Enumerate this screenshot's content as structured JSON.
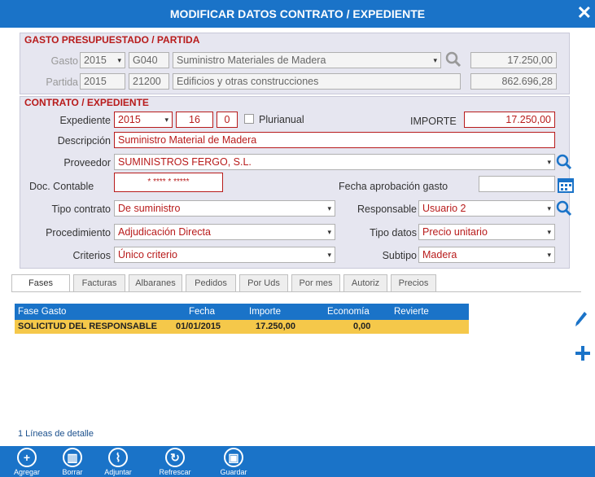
{
  "title": "MODIFICAR DATOS CONTRATO / EXPEDIENTE",
  "gasto_section": {
    "title": "GASTO PRESUPUESTADO / PARTIDA",
    "gasto_label": "Gasto",
    "gasto_year": "2015",
    "gasto_code": "G040",
    "gasto_desc": "Suministro Materiales de Madera",
    "gasto_amount": "17.250,00",
    "partida_label": "Partida",
    "partida_year": "2015",
    "partida_code": "21200",
    "partida_desc": "Edificios y otras construcciones",
    "partida_amount": "862.696,28"
  },
  "contrato_section": {
    "title": "CONTRATO / EXPEDIENTE",
    "expediente_label": "Expediente",
    "expediente_year": "2015",
    "expediente_num": "16",
    "expediente_sub": "0",
    "plurianual_label": "Plurianual",
    "importe_label": "IMPORTE",
    "importe_value": "17.250,00",
    "descripcion_label": "Descripción",
    "descripcion_value": "Suministro Material de Madera",
    "proveedor_label": "Proveedor",
    "proveedor_value": "SUMINISTROS FERGO, S.L.",
    "doc_contable_label": "Doc. Contable",
    "doc_contable_value": "* **** * *****",
    "fecha_aprobacion_label": "Fecha aprobación gasto",
    "fecha_aprobacion_value": "",
    "tipo_contrato_label": "Tipo contrato",
    "tipo_contrato_value": "De suministro",
    "responsable_label": "Responsable",
    "responsable_value": "Usuario 2",
    "procedimiento_label": "Procedimiento",
    "procedimiento_value": "Adjudicación Directa",
    "tipo_datos_label": "Tipo datos",
    "tipo_datos_value": "Precio unitario",
    "criterios_label": "Criterios",
    "criterios_value": "Único criterio",
    "subtipo_label": "Subtipo",
    "subtipo_value": "Madera"
  },
  "tabs": [
    "Fases",
    "Facturas",
    "Albaranes",
    "Pedidos",
    "Por Uds",
    "Por mes",
    "Autoriz",
    "Precios"
  ],
  "grid": {
    "headers": [
      "Fase Gasto",
      "Fecha",
      "Importe",
      "Economía",
      "Revierte"
    ],
    "rows": [
      [
        "SOLICITUD DEL RESPONSABLE",
        "01/01/2015",
        "17.250,00",
        "0,00",
        ""
      ]
    ],
    "footer": "1 Líneas de detalle"
  },
  "bottom_buttons": [
    "Agregar",
    "Borrar",
    "Adjuntar",
    "Refrescar",
    "Guardar"
  ],
  "colors": {
    "accent": "#1a73c8",
    "section": "#b81b1b",
    "row_selected": "#f5c84a"
  }
}
